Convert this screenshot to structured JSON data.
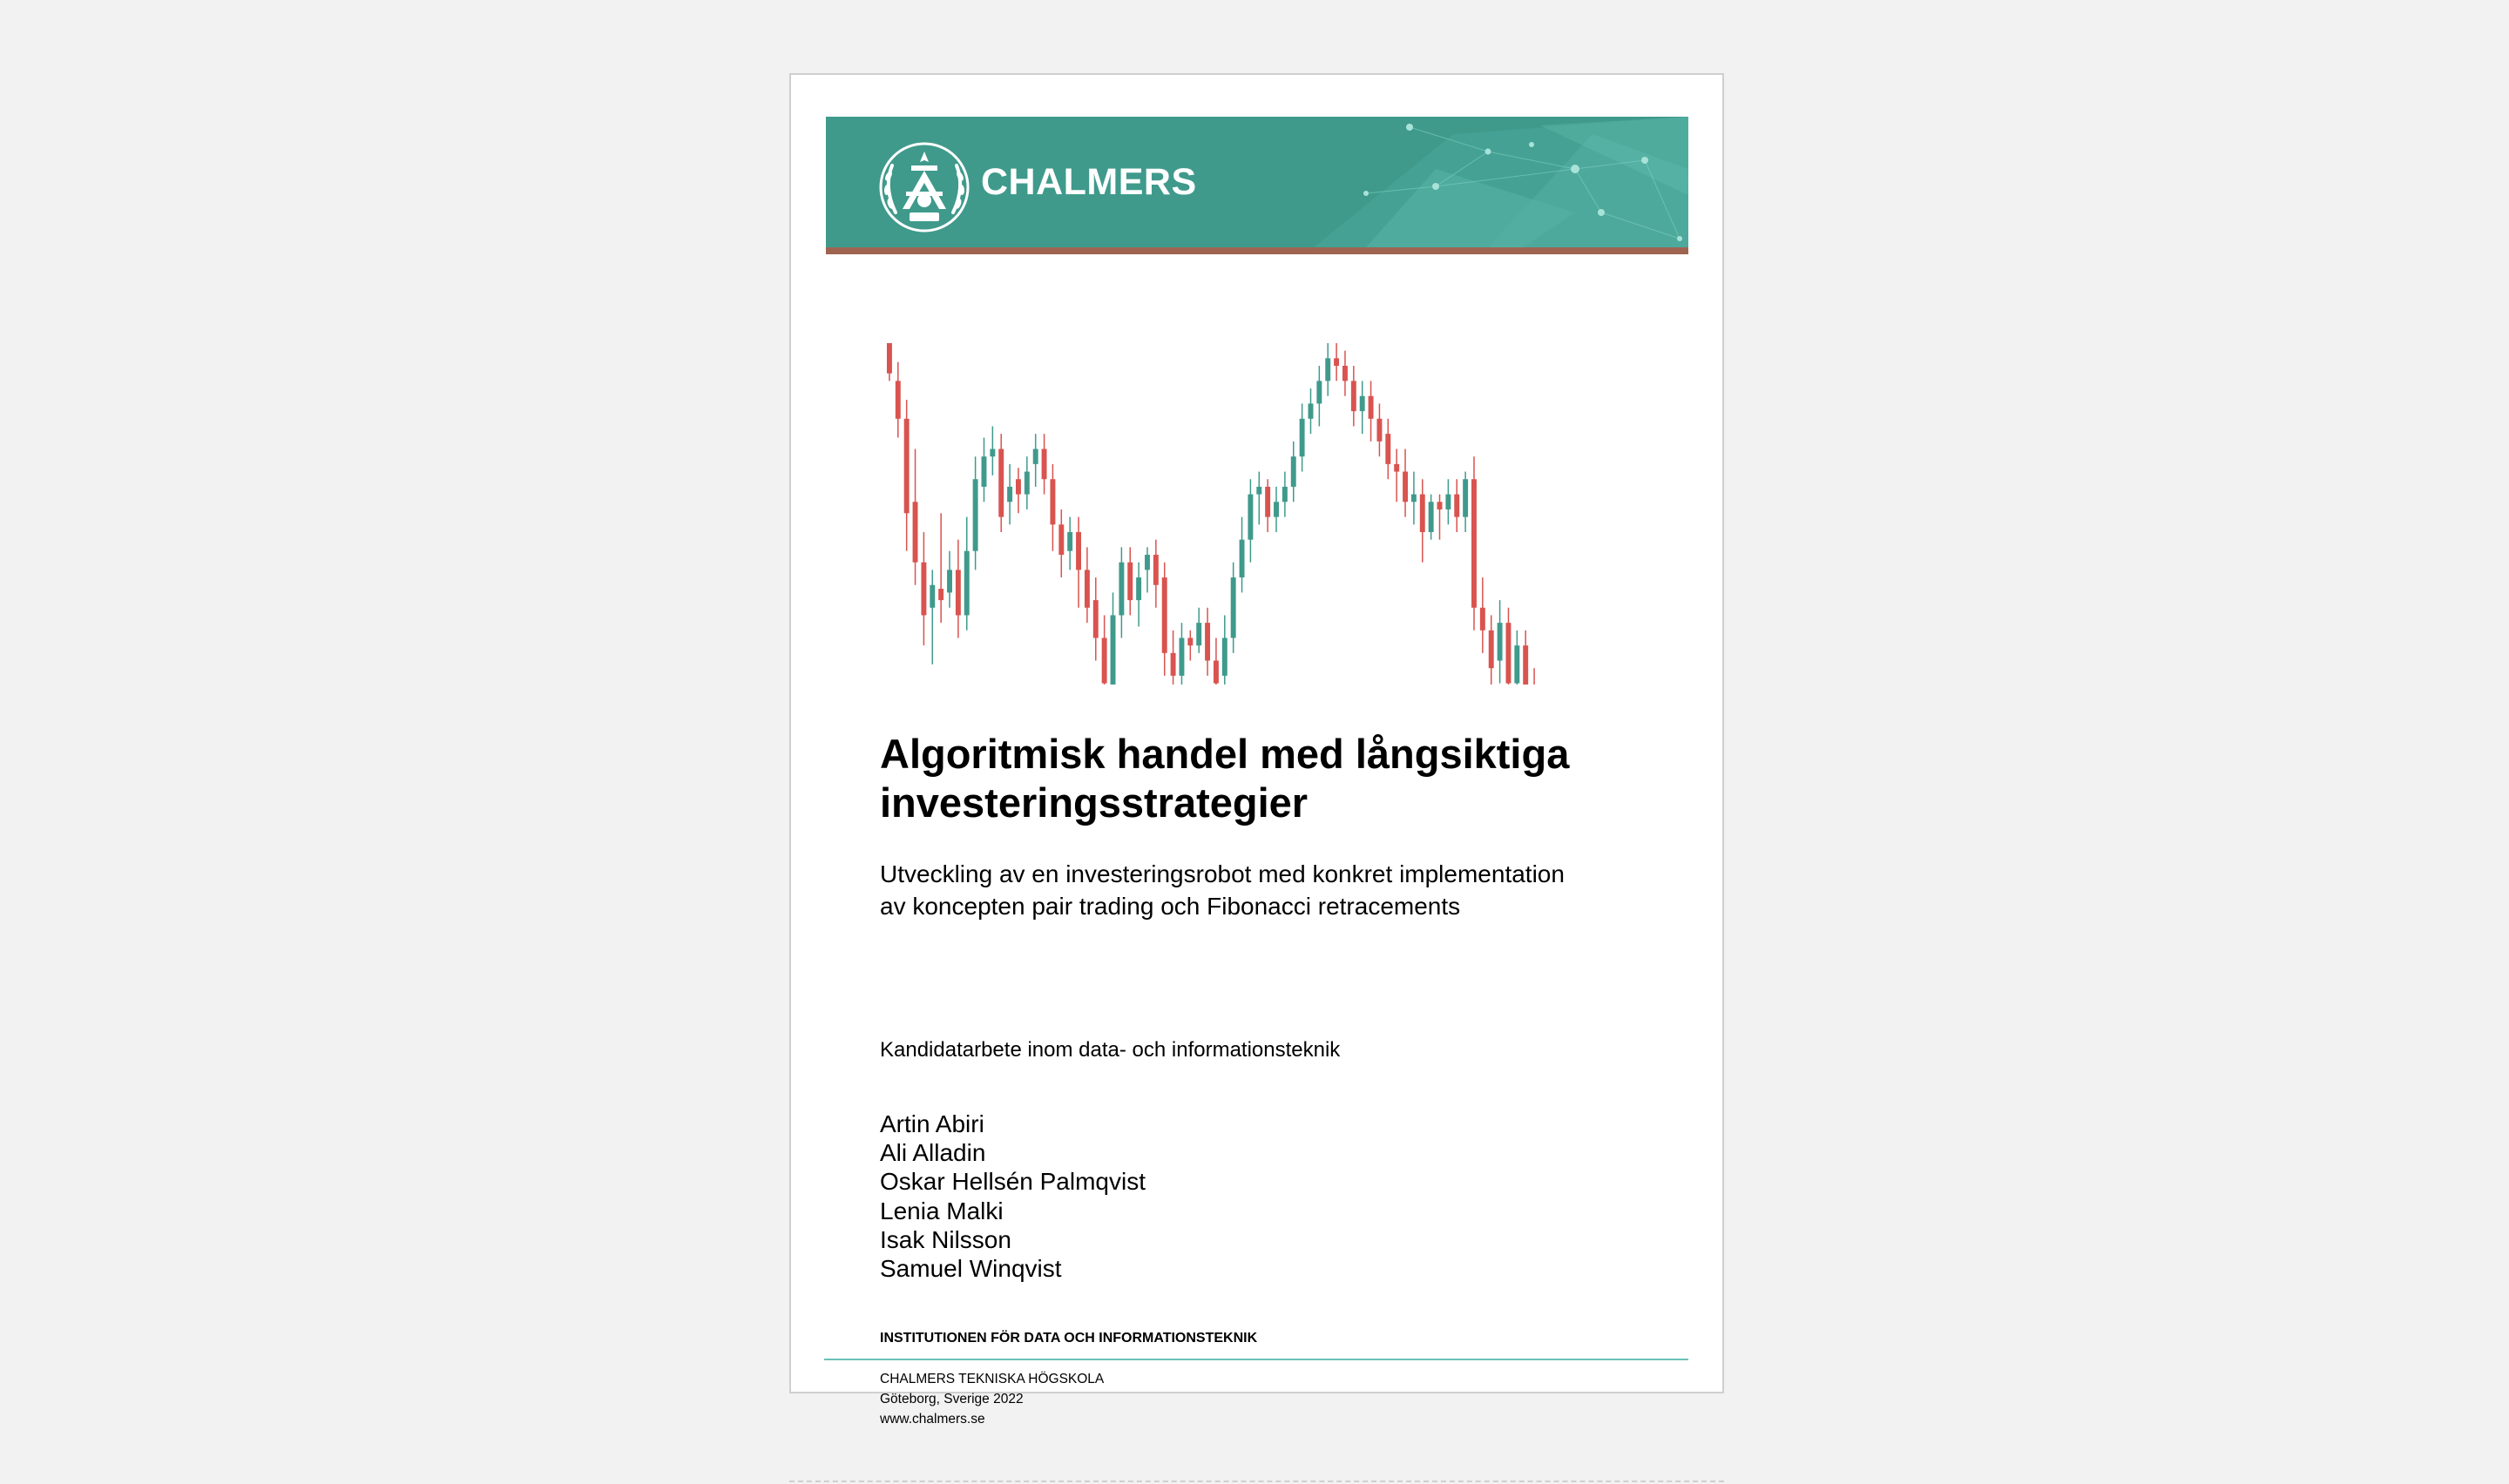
{
  "banner": {
    "brand_name": "CHALMERS",
    "colors": {
      "teal": "#3f9a8c",
      "stripe": "#9e6450"
    },
    "seal_icon": "chalmers-seal-icon"
  },
  "cover_chart": {
    "type": "candlestick",
    "colors": {
      "up": "#3f9a8c",
      "down": "#d9534f"
    },
    "candles": [
      [
        0,
        8,
        0,
        10,
        "d"
      ],
      [
        10,
        20,
        5,
        25,
        "d"
      ],
      [
        20,
        45,
        15,
        55,
        "d"
      ],
      [
        42,
        58,
        28,
        64,
        "d"
      ],
      [
        58,
        72,
        50,
        80,
        "d"
      ],
      [
        70,
        64,
        60,
        85,
        "u"
      ],
      [
        65,
        68,
        45,
        74,
        "d"
      ],
      [
        66,
        60,
        55,
        70,
        "u"
      ],
      [
        60,
        72,
        52,
        78,
        "d"
      ],
      [
        72,
        55,
        46,
        76,
        "u"
      ],
      [
        55,
        36,
        30,
        60,
        "u"
      ],
      [
        38,
        30,
        25,
        42,
        "u"
      ],
      [
        30,
        28,
        22,
        35,
        "u"
      ],
      [
        28,
        46,
        24,
        50,
        "d"
      ],
      [
        42,
        38,
        32,
        48,
        "u"
      ],
      [
        36,
        40,
        33,
        45,
        "d"
      ],
      [
        40,
        34,
        30,
        44,
        "u"
      ],
      [
        32,
        28,
        24,
        38,
        "u"
      ],
      [
        28,
        36,
        24,
        40,
        "d"
      ],
      [
        36,
        48,
        32,
        55,
        "d"
      ],
      [
        48,
        56,
        44,
        62,
        "d"
      ],
      [
        55,
        50,
        46,
        60,
        "u"
      ],
      [
        50,
        60,
        46,
        70,
        "d"
      ],
      [
        60,
        70,
        54,
        74,
        "d"
      ],
      [
        68,
        78,
        62,
        84,
        "d"
      ],
      [
        78,
        90,
        72,
        96,
        "d"
      ],
      [
        92,
        72,
        66,
        100,
        "u"
      ],
      [
        72,
        58,
        54,
        78,
        "u"
      ],
      [
        58,
        68,
        54,
        72,
        "d"
      ],
      [
        68,
        62,
        58,
        75,
        "u"
      ],
      [
        60,
        56,
        54,
        66,
        "u"
      ],
      [
        56,
        64,
        52,
        70,
        "d"
      ],
      [
        62,
        82,
        58,
        88,
        "d"
      ],
      [
        82,
        88,
        76,
        92,
        "d"
      ],
      [
        88,
        78,
        74,
        92,
        "u"
      ],
      [
        78,
        80,
        76,
        84,
        "d"
      ],
      [
        80,
        74,
        70,
        82,
        "u"
      ],
      [
        74,
        84,
        70,
        88,
        "d"
      ],
      [
        84,
        90,
        78,
        94,
        "d"
      ],
      [
        88,
        78,
        72,
        92,
        "u"
      ],
      [
        78,
        62,
        58,
        82,
        "u"
      ],
      [
        62,
        52,
        46,
        66,
        "u"
      ],
      [
        52,
        40,
        36,
        58,
        "u"
      ],
      [
        40,
        38,
        34,
        48,
        "u"
      ],
      [
        38,
        46,
        36,
        50,
        "d"
      ],
      [
        46,
        42,
        38,
        50,
        "u"
      ],
      [
        42,
        38,
        34,
        46,
        "u"
      ],
      [
        38,
        30,
        26,
        42,
        "u"
      ],
      [
        30,
        20,
        16,
        34,
        "u"
      ],
      [
        20,
        16,
        12,
        24,
        "u"
      ],
      [
        16,
        10,
        6,
        22,
        "u"
      ],
      [
        10,
        4,
        0,
        14,
        "u"
      ],
      [
        4,
        6,
        0,
        10,
        "d"
      ],
      [
        6,
        10,
        2,
        14,
        "d"
      ],
      [
        10,
        18,
        6,
        22,
        "d"
      ],
      [
        18,
        14,
        10,
        24,
        "u"
      ],
      [
        14,
        20,
        10,
        26,
        "d"
      ],
      [
        20,
        26,
        16,
        30,
        "d"
      ],
      [
        24,
        32,
        20,
        36,
        "d"
      ],
      [
        32,
        34,
        28,
        42,
        "d"
      ],
      [
        34,
        42,
        28,
        46,
        "d"
      ],
      [
        42,
        40,
        34,
        48,
        "u"
      ],
      [
        40,
        50,
        36,
        58,
        "d"
      ],
      [
        50,
        42,
        40,
        52,
        "u"
      ],
      [
        42,
        44,
        40,
        52,
        "d"
      ],
      [
        44,
        40,
        36,
        48,
        "u"
      ],
      [
        40,
        46,
        36,
        50,
        "d"
      ],
      [
        46,
        36,
        34,
        50,
        "u"
      ],
      [
        36,
        70,
        30,
        76,
        "d"
      ],
      [
        70,
        76,
        62,
        82,
        "d"
      ],
      [
        76,
        86,
        72,
        92,
        "d"
      ],
      [
        84,
        74,
        68,
        90,
        "u"
      ],
      [
        74,
        90,
        70,
        96,
        "d"
      ],
      [
        90,
        80,
        76,
        100,
        "u"
      ],
      [
        80,
        92,
        76,
        98,
        "d"
      ],
      [
        92,
        100,
        86,
        106,
        "d"
      ]
    ]
  },
  "title": {
    "line1": "Algoritmisk handel med långsiktiga",
    "line2": "investeringsstrategier"
  },
  "subtitle": {
    "line1": "Utveckling av en investeringsrobot med konkret implementation",
    "line2": "av koncepten pair trading och Fibonacci retracements"
  },
  "degree": "Kandidatarbete inom data- och informationsteknik",
  "authors": [
    "Artin Abiri",
    "Ali Alladin",
    "Oskar Hellsén Palmqvist",
    "Lenia Malki",
    "Isak Nilsson",
    "Samuel Winqvist"
  ],
  "department": "INSTITUTIONEN FÖR DATA OCH INFORMATIONSTEKNIK",
  "footer": {
    "school": "CHALMERS TEKNISKA HÖGSKOLA",
    "place_year": "Göteborg, Sverige 2022",
    "website": "www.chalmers.se"
  }
}
